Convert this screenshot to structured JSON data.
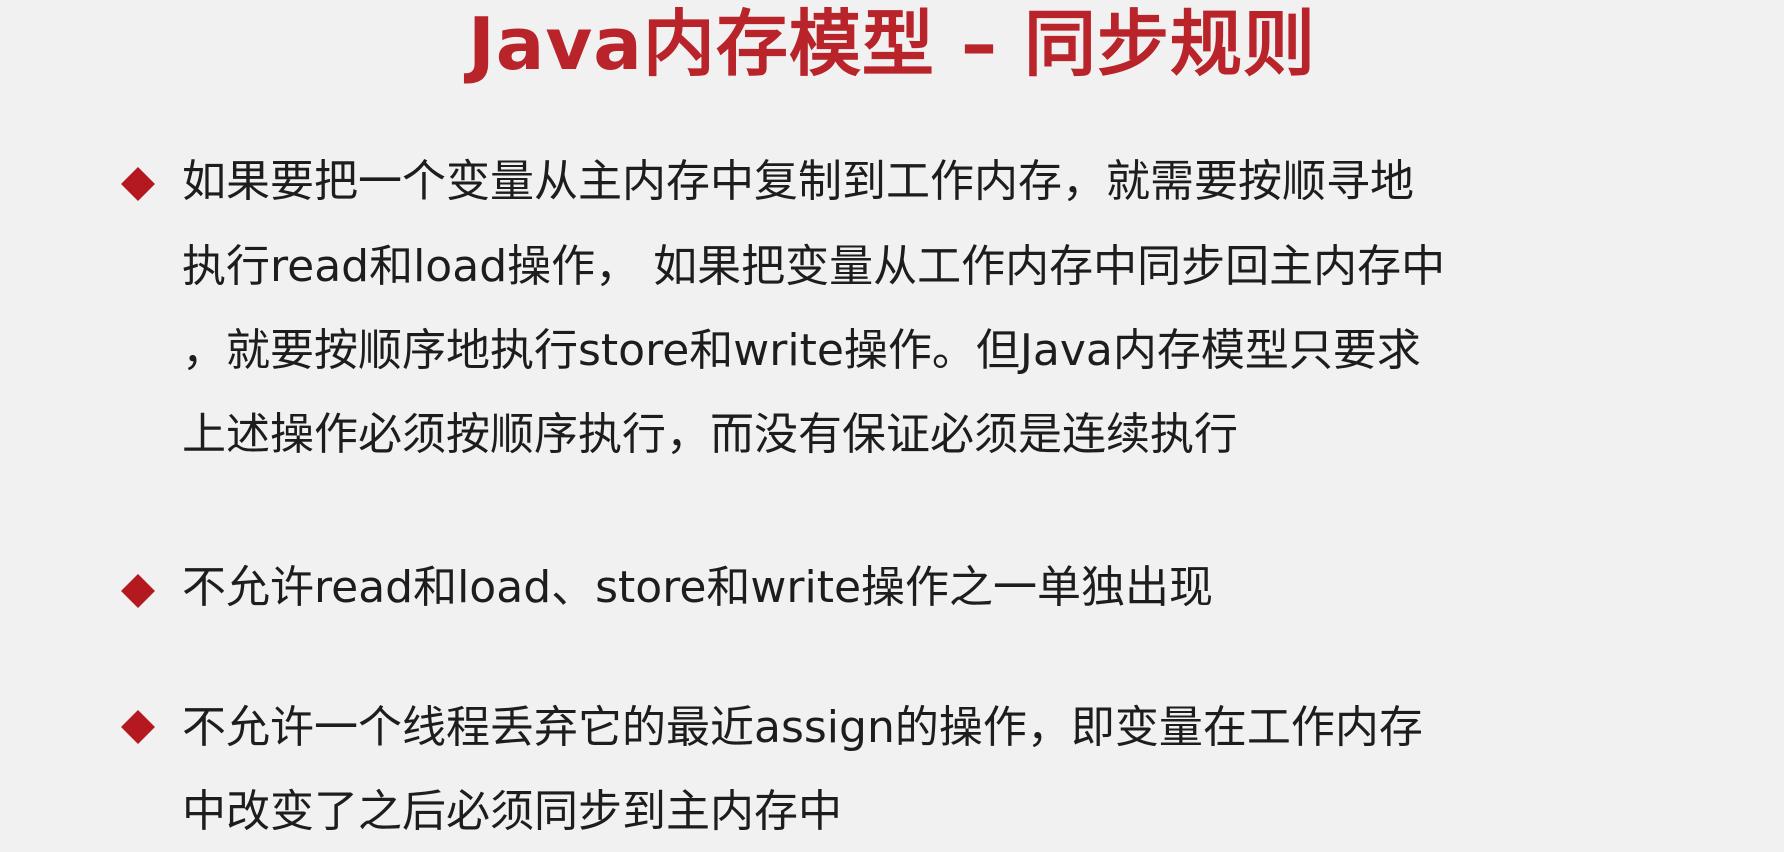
{
  "slide": {
    "title": "Java内存模型 – 同步规则",
    "bullets": [
      {
        "lines": [
          "如果要把一个变量从主内存中复制到工作内存，就需要按顺寻地",
          "执行read和load操作， 如果把变量从工作内存中同步回主内存中",
          "，就要按顺序地执行store和write操作。但Java内存模型只要求",
          "上述操作必须按顺序执行，而没有保证必须是连续执行"
        ]
      },
      {
        "lines": [
          "不允许read和load、store和write操作之一单独出现"
        ]
      },
      {
        "lines": [
          "不允许一个线程丢弃它的最近assign的操作，即变量在工作内存",
          "中改变了之后必须同步到主内存中"
        ]
      }
    ]
  },
  "colors": {
    "title": "#b8242a",
    "bullet": "#b3191f",
    "text": "#1d1d1d",
    "background": "#f1f1f1"
  }
}
